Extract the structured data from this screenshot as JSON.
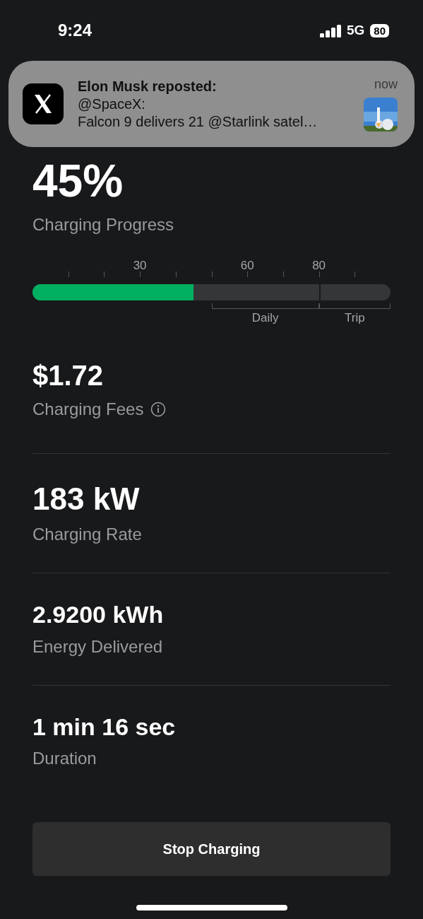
{
  "status_bar": {
    "time": "9:24",
    "network": "5G",
    "battery": "80"
  },
  "notification": {
    "title": "Elon Musk reposted:",
    "line1": "@SpaceX:",
    "line2": "Falcon 9 delivers 21 @Starlink satel…",
    "time": "now"
  },
  "progress": {
    "value": "45%",
    "label": "Charging Progress",
    "level": 0.45,
    "scale_labels": [
      "30",
      "60",
      "80"
    ],
    "ranges": [
      "Daily",
      "Trip"
    ]
  },
  "stats": [
    {
      "value": "$1.72",
      "label": "Charging Fees",
      "info": true
    },
    {
      "value": "183 kW",
      "label": "Charging Rate",
      "info": false
    },
    {
      "value": "2.9200 kWh",
      "label": "Energy Delivered",
      "info": false
    },
    {
      "value": "1 min 16 sec",
      "label": "Duration",
      "info": false
    }
  ],
  "button": "Stop Charging"
}
